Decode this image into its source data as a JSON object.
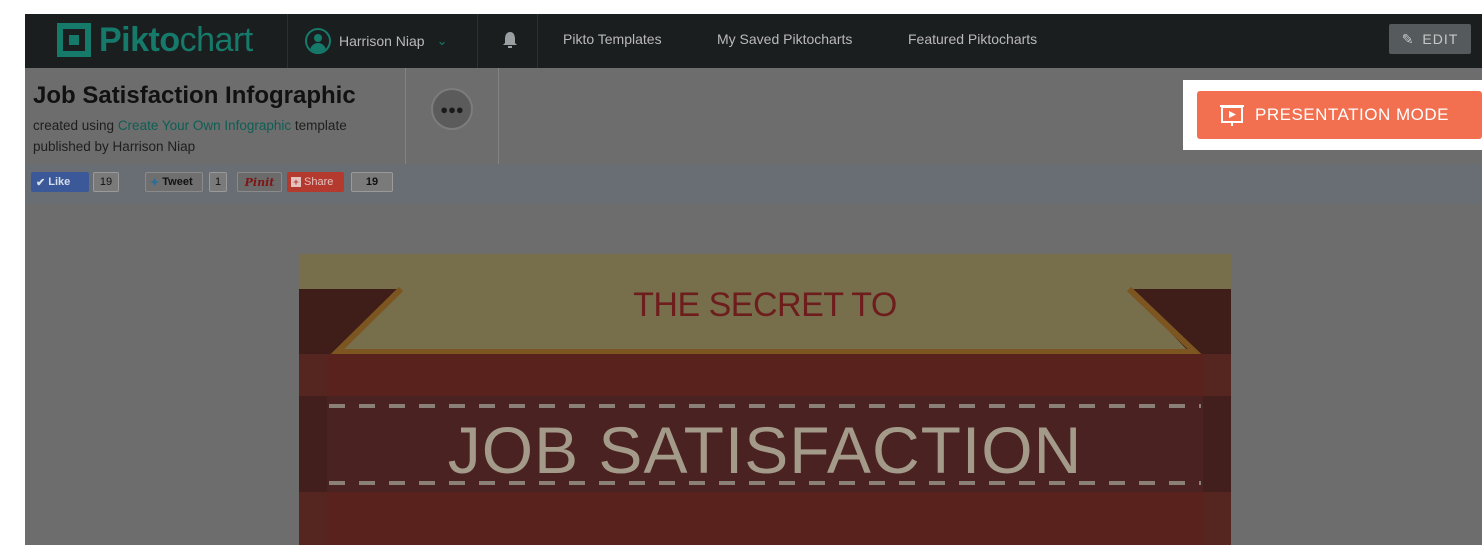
{
  "brand": {
    "logo_bold": "Pikto",
    "logo_light": "chart"
  },
  "nav": {
    "user_name": "Harrison Niap",
    "links": [
      "Pikto Templates",
      "My Saved Piktocharts",
      "Featured Piktocharts"
    ],
    "edit_label": "EDIT"
  },
  "header": {
    "title": "Job Satisfaction Infographic",
    "created_prefix": "created using ",
    "template_name": "Create Your Own Infographic",
    "created_suffix": " template",
    "published_by": "published by Harrison Niap",
    "presentation_label": "PRESENTATION MODE"
  },
  "social": {
    "like_label": "Like",
    "like_count": "19",
    "tweet_label": "Tweet",
    "tweet_count": "1",
    "pin_label": "Pinit",
    "share_label": "Share",
    "share_count": "19"
  },
  "infographic": {
    "kicker": "THE SECRET TO",
    "headline": "JOB SATISFACTION"
  },
  "colors": {
    "brand_teal": "#167a6b",
    "accent_orange": "#f27050",
    "navbar_bg": "#1b1e1f",
    "overlay_gray": "#6d6d6d"
  }
}
